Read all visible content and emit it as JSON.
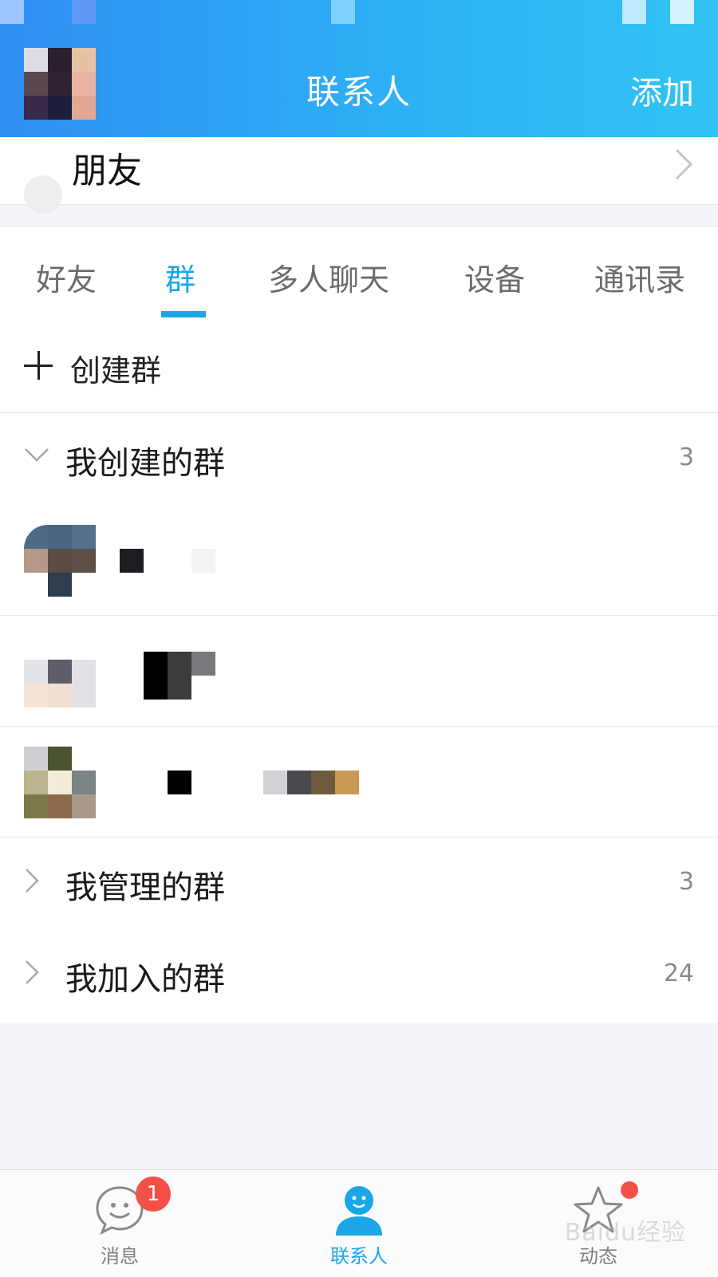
{
  "header": {
    "title": "联系人",
    "add_label": "添加"
  },
  "friend_row": {
    "label": "朋友"
  },
  "tabs": [
    {
      "label": "好友",
      "active": false
    },
    {
      "label": "群",
      "active": true
    },
    {
      "label": "多人聊天",
      "active": false
    },
    {
      "label": "设备",
      "active": false
    },
    {
      "label": "通讯录",
      "active": false
    }
  ],
  "create_group": {
    "label": "创建群"
  },
  "groups": {
    "created": {
      "label": "我创建的群",
      "count": "3",
      "expanded": true
    },
    "managed": {
      "label": "我管理的群",
      "count": "3",
      "expanded": false
    },
    "joined": {
      "label": "我加入的群",
      "count": "24",
      "expanded": false
    }
  },
  "tabbar": {
    "messages": {
      "label": "消息",
      "badge": "1"
    },
    "contacts": {
      "label": "联系人"
    },
    "activity": {
      "label": "动态"
    }
  },
  "watermark": "Baidu经验",
  "colors": {
    "accent": "#1aa6e8",
    "header_start": "#2f8ff2",
    "header_end": "#31c3f4",
    "badge": "#f35048"
  }
}
